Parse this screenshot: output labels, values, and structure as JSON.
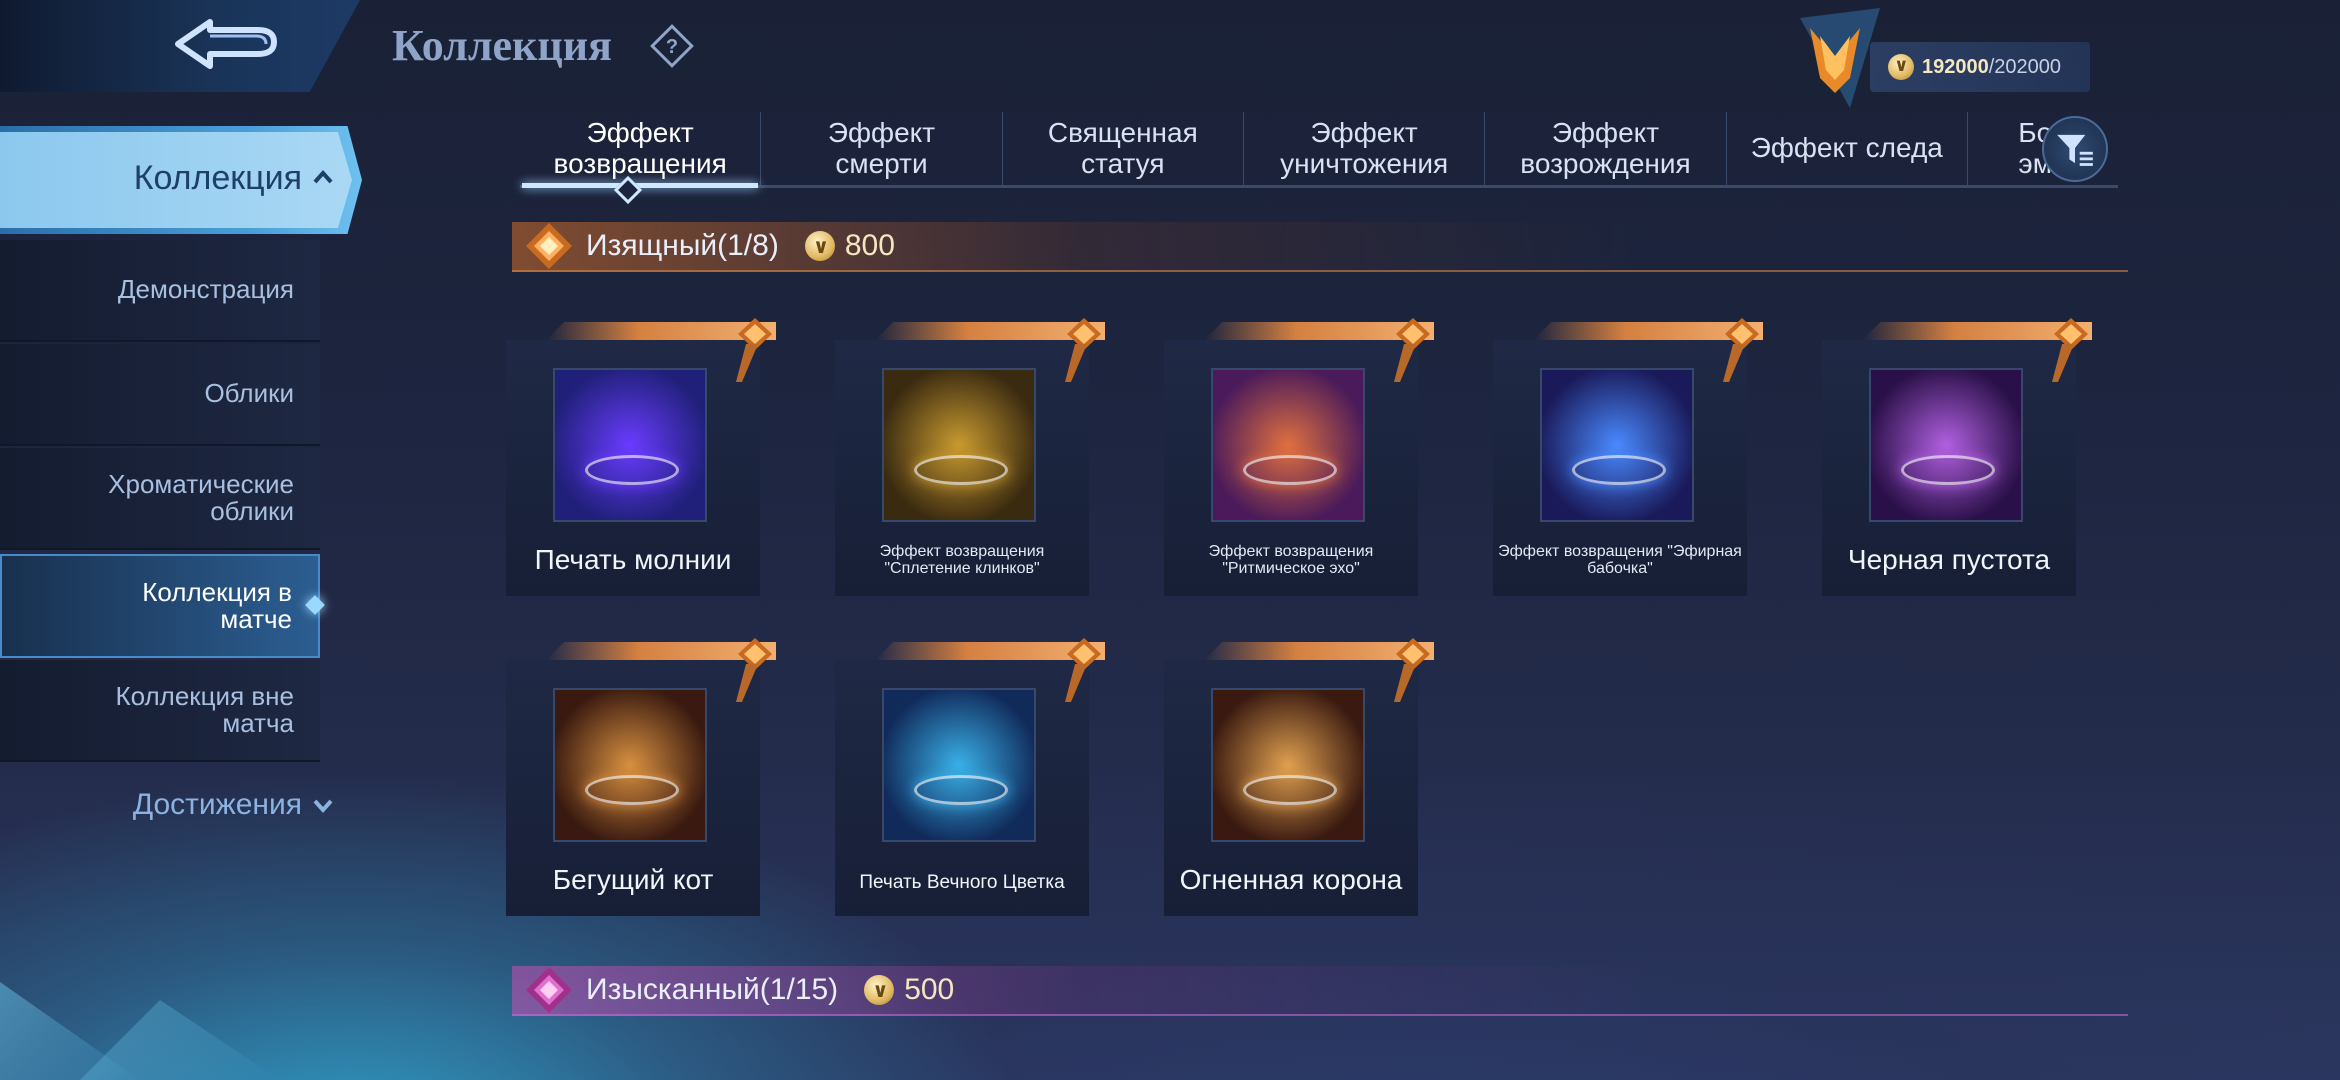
{
  "header": {
    "back_icon": "back-arrow-icon",
    "title": "Коллекция",
    "help_icon": "question-diamond-icon"
  },
  "currency": {
    "icon": "collection-coin-icon",
    "value": "192000",
    "max": "/202000"
  },
  "sidebar": {
    "active_group": "Коллекция",
    "items": [
      {
        "label": "Демонстрация"
      },
      {
        "label": "Облики"
      },
      {
        "label": "Хроматические облики"
      },
      {
        "label": "Коллекция в матче",
        "active": true
      },
      {
        "label": "Коллекция вне матча"
      }
    ],
    "collapsed_group": "Достижения"
  },
  "tabs": [
    {
      "label": "Эффект возвращения",
      "active": true
    },
    {
      "label": "Эффект смерти"
    },
    {
      "label": "Священная статуя"
    },
    {
      "label": "Эффект уничтожения"
    },
    {
      "label": "Эффект возрождения"
    },
    {
      "label": "Эффект следа"
    },
    {
      "label": "Бое эмо"
    }
  ],
  "filter_icon": "filter-funnel-icon",
  "sections": [
    {
      "label": "Изящный(1/8)",
      "price": "800",
      "color": "#d48040",
      "items": [
        {
          "name": "Печать молнии",
          "size": "big",
          "thumb_colors": [
            "#6a3cff",
            "#20207a"
          ]
        },
        {
          "name": "Эффект возвращения \"Сплетение клинков\"",
          "size": "small",
          "thumb_colors": [
            "#c89a30",
            "#3a2a10"
          ]
        },
        {
          "name": "Эффект возвращения \"Ритмическое эхо\"",
          "size": "small",
          "thumb_colors": [
            "#e07040",
            "#4a1a5a"
          ]
        },
        {
          "name": "Эффект возвращения \"Эфирная бабочка\"",
          "size": "small",
          "thumb_colors": [
            "#4a8aff",
            "#1a1a5a"
          ]
        },
        {
          "name": "Черная пустота",
          "size": "big",
          "thumb_colors": [
            "#b060e0",
            "#2a1048"
          ]
        },
        {
          "name": "Бегущий кот",
          "size": "big",
          "thumb_colors": [
            "#d89040",
            "#3a1a10"
          ]
        },
        {
          "name": "Печать Вечного Цветка",
          "size": "medium",
          "thumb_colors": [
            "#3ab0e8",
            "#102a5a"
          ]
        },
        {
          "name": "Огненная корона",
          "size": "big",
          "thumb_colors": [
            "#e0a050",
            "#3a1a10"
          ]
        }
      ]
    },
    {
      "label": "Изысканный(1/15)",
      "price": "500",
      "color": "#c050c0"
    }
  ]
}
